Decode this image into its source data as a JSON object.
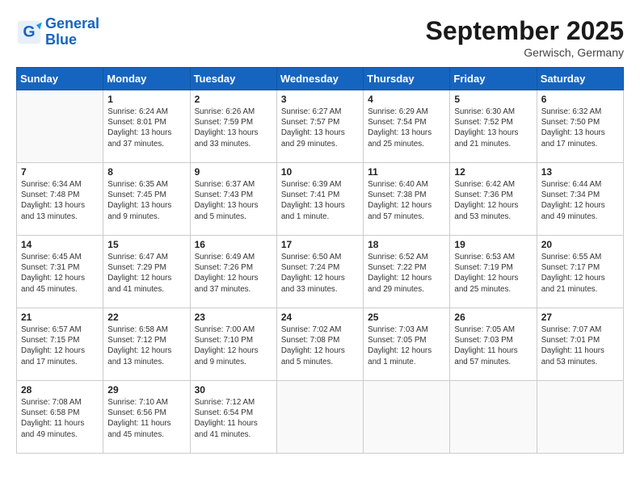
{
  "logo": {
    "line1": "General",
    "line2": "Blue"
  },
  "title": "September 2025",
  "location": "Gerwisch, Germany",
  "weekdays": [
    "Sunday",
    "Monday",
    "Tuesday",
    "Wednesday",
    "Thursday",
    "Friday",
    "Saturday"
  ],
  "weeks": [
    [
      {
        "day": "",
        "info": ""
      },
      {
        "day": "1",
        "info": "Sunrise: 6:24 AM\nSunset: 8:01 PM\nDaylight: 13 hours\nand 37 minutes."
      },
      {
        "day": "2",
        "info": "Sunrise: 6:26 AM\nSunset: 7:59 PM\nDaylight: 13 hours\nand 33 minutes."
      },
      {
        "day": "3",
        "info": "Sunrise: 6:27 AM\nSunset: 7:57 PM\nDaylight: 13 hours\nand 29 minutes."
      },
      {
        "day": "4",
        "info": "Sunrise: 6:29 AM\nSunset: 7:54 PM\nDaylight: 13 hours\nand 25 minutes."
      },
      {
        "day": "5",
        "info": "Sunrise: 6:30 AM\nSunset: 7:52 PM\nDaylight: 13 hours\nand 21 minutes."
      },
      {
        "day": "6",
        "info": "Sunrise: 6:32 AM\nSunset: 7:50 PM\nDaylight: 13 hours\nand 17 minutes."
      }
    ],
    [
      {
        "day": "7",
        "info": "Sunrise: 6:34 AM\nSunset: 7:48 PM\nDaylight: 13 hours\nand 13 minutes."
      },
      {
        "day": "8",
        "info": "Sunrise: 6:35 AM\nSunset: 7:45 PM\nDaylight: 13 hours\nand 9 minutes."
      },
      {
        "day": "9",
        "info": "Sunrise: 6:37 AM\nSunset: 7:43 PM\nDaylight: 13 hours\nand 5 minutes."
      },
      {
        "day": "10",
        "info": "Sunrise: 6:39 AM\nSunset: 7:41 PM\nDaylight: 13 hours\nand 1 minute."
      },
      {
        "day": "11",
        "info": "Sunrise: 6:40 AM\nSunset: 7:38 PM\nDaylight: 12 hours\nand 57 minutes."
      },
      {
        "day": "12",
        "info": "Sunrise: 6:42 AM\nSunset: 7:36 PM\nDaylight: 12 hours\nand 53 minutes."
      },
      {
        "day": "13",
        "info": "Sunrise: 6:44 AM\nSunset: 7:34 PM\nDaylight: 12 hours\nand 49 minutes."
      }
    ],
    [
      {
        "day": "14",
        "info": "Sunrise: 6:45 AM\nSunset: 7:31 PM\nDaylight: 12 hours\nand 45 minutes."
      },
      {
        "day": "15",
        "info": "Sunrise: 6:47 AM\nSunset: 7:29 PM\nDaylight: 12 hours\nand 41 minutes."
      },
      {
        "day": "16",
        "info": "Sunrise: 6:49 AM\nSunset: 7:26 PM\nDaylight: 12 hours\nand 37 minutes."
      },
      {
        "day": "17",
        "info": "Sunrise: 6:50 AM\nSunset: 7:24 PM\nDaylight: 12 hours\nand 33 minutes."
      },
      {
        "day": "18",
        "info": "Sunrise: 6:52 AM\nSunset: 7:22 PM\nDaylight: 12 hours\nand 29 minutes."
      },
      {
        "day": "19",
        "info": "Sunrise: 6:53 AM\nSunset: 7:19 PM\nDaylight: 12 hours\nand 25 minutes."
      },
      {
        "day": "20",
        "info": "Sunrise: 6:55 AM\nSunset: 7:17 PM\nDaylight: 12 hours\nand 21 minutes."
      }
    ],
    [
      {
        "day": "21",
        "info": "Sunrise: 6:57 AM\nSunset: 7:15 PM\nDaylight: 12 hours\nand 17 minutes."
      },
      {
        "day": "22",
        "info": "Sunrise: 6:58 AM\nSunset: 7:12 PM\nDaylight: 12 hours\nand 13 minutes."
      },
      {
        "day": "23",
        "info": "Sunrise: 7:00 AM\nSunset: 7:10 PM\nDaylight: 12 hours\nand 9 minutes."
      },
      {
        "day": "24",
        "info": "Sunrise: 7:02 AM\nSunset: 7:08 PM\nDaylight: 12 hours\nand 5 minutes."
      },
      {
        "day": "25",
        "info": "Sunrise: 7:03 AM\nSunset: 7:05 PM\nDaylight: 12 hours\nand 1 minute."
      },
      {
        "day": "26",
        "info": "Sunrise: 7:05 AM\nSunset: 7:03 PM\nDaylight: 11 hours\nand 57 minutes."
      },
      {
        "day": "27",
        "info": "Sunrise: 7:07 AM\nSunset: 7:01 PM\nDaylight: 11 hours\nand 53 minutes."
      }
    ],
    [
      {
        "day": "28",
        "info": "Sunrise: 7:08 AM\nSunset: 6:58 PM\nDaylight: 11 hours\nand 49 minutes."
      },
      {
        "day": "29",
        "info": "Sunrise: 7:10 AM\nSunset: 6:56 PM\nDaylight: 11 hours\nand 45 minutes."
      },
      {
        "day": "30",
        "info": "Sunrise: 7:12 AM\nSunset: 6:54 PM\nDaylight: 11 hours\nand 41 minutes."
      },
      {
        "day": "",
        "info": ""
      },
      {
        "day": "",
        "info": ""
      },
      {
        "day": "",
        "info": ""
      },
      {
        "day": "",
        "info": ""
      }
    ]
  ]
}
